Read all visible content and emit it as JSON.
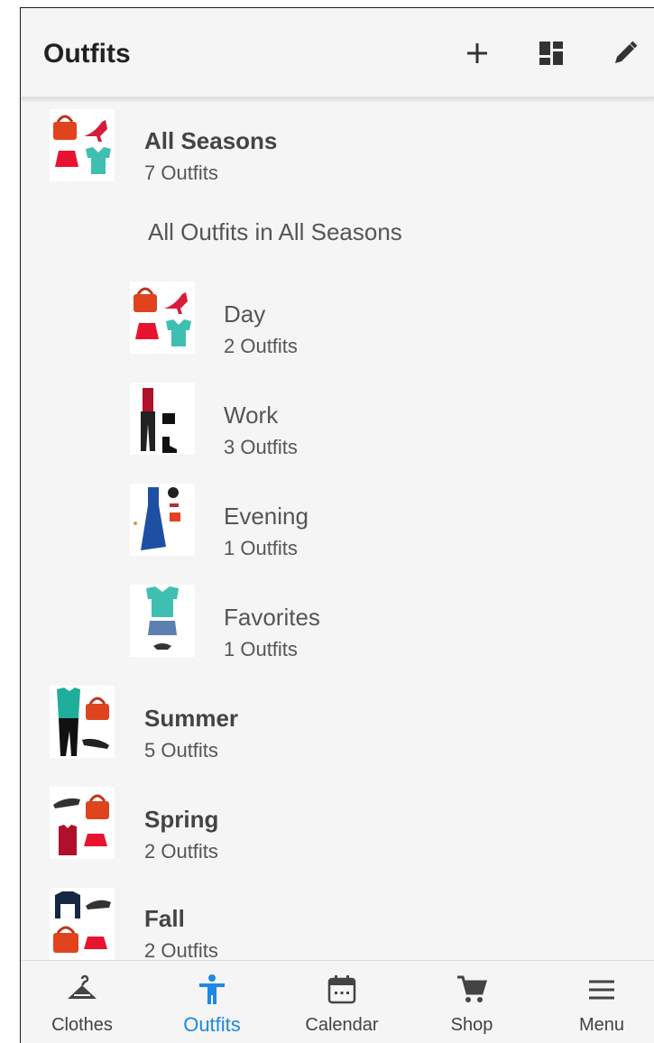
{
  "appbar": {
    "title": "Outfits",
    "actions": [
      {
        "name": "add-icon"
      },
      {
        "name": "dashboard-icon"
      },
      {
        "name": "edit-icon"
      }
    ]
  },
  "groups": [
    {
      "title": "All Seasons",
      "count": "7 Outfits"
    }
  ],
  "section_header": "All Outfits in All Seasons",
  "subgroups": [
    {
      "title": "Day",
      "count": "2 Outfits"
    },
    {
      "title": "Work",
      "count": "3 Outfits"
    },
    {
      "title": "Evening",
      "count": "1 Outfits"
    },
    {
      "title": "Favorites",
      "count": "1 Outfits"
    }
  ],
  "seasons": [
    {
      "title": "Summer",
      "count": "5 Outfits"
    },
    {
      "title": "Spring",
      "count": "2 Outfits"
    },
    {
      "title": "Fall",
      "count": "2 Outfits"
    }
  ],
  "bottom_nav": [
    {
      "label": "Clothes",
      "icon": "hanger-icon"
    },
    {
      "label": "Outfits",
      "icon": "person-icon",
      "active": true
    },
    {
      "label": "Calendar",
      "icon": "calendar-icon"
    },
    {
      "label": "Shop",
      "icon": "cart-icon"
    },
    {
      "label": "Menu",
      "icon": "menu-icon"
    }
  ],
  "colors": {
    "accent": "#1e88e5",
    "background": "#f5f5f5",
    "text": "#212121"
  }
}
